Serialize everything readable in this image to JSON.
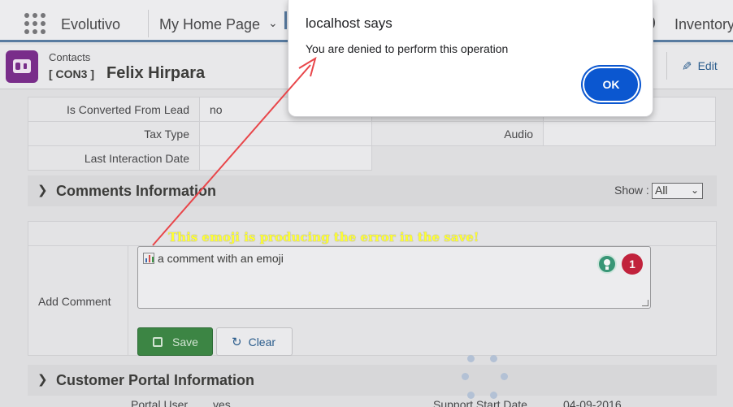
{
  "topbar": {
    "app_name": "Evolutivo",
    "home_menu": "My Home Page",
    "inventory_menu": "Inventory"
  },
  "record": {
    "module": "Contacts",
    "record_no": "[ CON3 ]",
    "name": "Felix Hirpara",
    "edit_label": "Edit"
  },
  "details": {
    "rows": [
      {
        "label": "Is Converted From Lead",
        "value": "no",
        "label2": "",
        "value2": ""
      },
      {
        "label": "Tax Type",
        "value": "",
        "label2": "Audio",
        "value2": ""
      },
      {
        "label": "Last Interaction Date",
        "value": ""
      }
    ]
  },
  "comments": {
    "section_title": "Comments Information",
    "show_label": "Show :",
    "show_value": "All",
    "add_comment_label": "Add Comment",
    "comment_text": "a comment with an emoji",
    "badge_count": "1",
    "save_label": "Save",
    "clear_label": "Clear"
  },
  "portal": {
    "section_title": "Customer Portal Information",
    "portal_user_label": "Portal User",
    "portal_user_value": "yes",
    "support_start_label": "Support Start Date",
    "support_start_value": "04-09-2016"
  },
  "dialog": {
    "title": "localhost says",
    "message": "You are denied to perform this operation",
    "ok_label": "OK"
  },
  "annotation": {
    "text": "This emoji is producing the error in the save!",
    "color": "#ffff33",
    "arrow_color": "#e8464a"
  },
  "colors": {
    "save_button": "#3e8a47",
    "dialog_button": "#0b57d0",
    "record_icon": "#7d2f8f"
  }
}
